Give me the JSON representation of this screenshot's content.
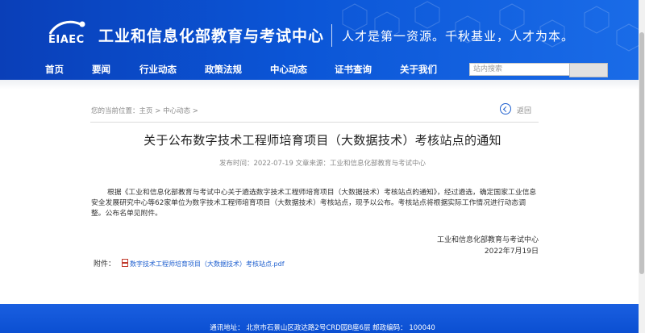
{
  "header": {
    "logo_text": "EIAEC",
    "site_title": "工业和信息化部教育与考试中心",
    "slogan": "人才是第一资源。千秋基业，人才为本。"
  },
  "nav": {
    "items": [
      {
        "label": "首页"
      },
      {
        "label": "要闻"
      },
      {
        "label": "行业动态"
      },
      {
        "label": "政策法规"
      },
      {
        "label": "中心动态"
      },
      {
        "label": "证书查询"
      },
      {
        "label": "关于我们"
      }
    ]
  },
  "search": {
    "placeholder": "站内搜索",
    "button_label": ""
  },
  "breadcrumb": {
    "prefix": "您的当前位置：",
    "home": "主页",
    "sep": " > ",
    "section": "中心动态",
    "end": " >"
  },
  "back": {
    "label": "返回"
  },
  "article": {
    "title": "关于公布数字技术工程师培育项目（大数据技术）考核站点的通知",
    "meta": "发布时间：2022-07-19  文章来源：工业和信息化部教育与考试中心",
    "paragraph": "根据《工业和信息化部教育与考试中心关于遴选数字技术工程师培育项目（大数据技术）考核站点的通知》，经过遴选，确定国家工业信息安全发展研究中心等62家单位为数字技术工程师培育项目（大数据技术）考核站点，现予以公布。考核站点将根据实际工作情况进行动态调整。公布名单见附件。",
    "sign_org": "工业和信息化部教育与考试中心",
    "sign_date": "2022年7月19日",
    "attach_label": "附件：",
    "attach_file": "数字技术工程师培育项目（大数据技术）考核站点.pdf"
  },
  "footer": {
    "text": "通讯地址：  北京市石景山区政达路2号CRD园B座6层 邮政编码：  100040"
  },
  "colors": {
    "header_blue": "#0b55d6",
    "link_blue": "#1e5fcf",
    "footer_blue": "#1a5fe0"
  }
}
